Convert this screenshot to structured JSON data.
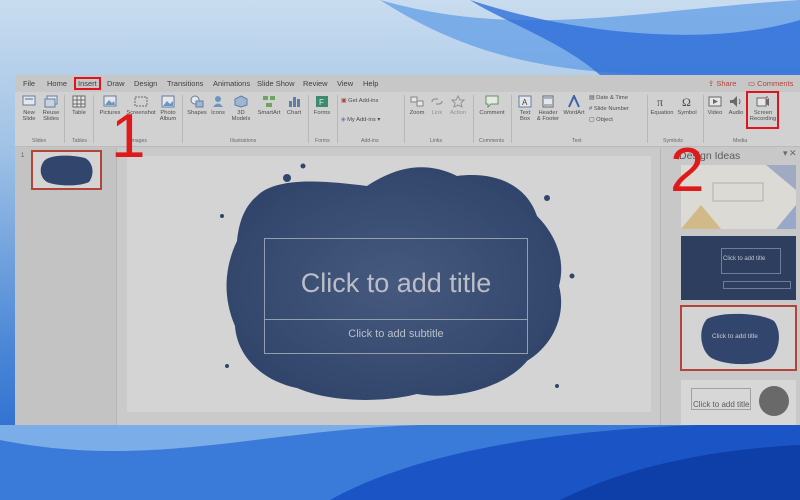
{
  "menubar": {
    "tabs": [
      "File",
      "Home",
      "Insert",
      "Draw",
      "Design",
      "Transitions",
      "Animations",
      "Slide Show",
      "Review",
      "View",
      "Help"
    ],
    "share": "Share",
    "comments": "Comments"
  },
  "ribbon": {
    "new_slide": "New\nSlide",
    "reuse_slides": "Reuse\nSlides",
    "table": "Table",
    "pictures": "Pictures",
    "screenshot": "Screenshot",
    "photo_album": "Photo\nAlbum",
    "shapes": "Shapes",
    "icons": "Icons",
    "models_3d": "3D\nModels",
    "smartart": "SmartArt",
    "chart": "Chart",
    "forms": "Forms",
    "get_addins": "Get Add-ins",
    "my_addins": "My Add-ins",
    "zoom": "Zoom",
    "link": "Link",
    "action": "Action",
    "comment": "Comment",
    "text_box": "Text\nBox",
    "header_footer": "Header\n& Footer",
    "wordart": "WordArt",
    "date_time": "Date & Time",
    "slide_number": "Slide Number",
    "object": "Object",
    "equation": "Equation",
    "symbol": "Symbol",
    "video": "Video",
    "audio": "Audio",
    "screen_recording": "Screen\nRecording",
    "groups": {
      "slides": "Slides",
      "tables": "Tables",
      "images": "Images",
      "illustrations": "Illustrations",
      "forms": "Forms",
      "addins": "Add-ins",
      "links": "Links",
      "comments": "Comments",
      "text": "Text",
      "symbols": "Symbols",
      "media": "Media"
    }
  },
  "thumbnails": {
    "slide_number": "1"
  },
  "slide": {
    "title_placeholder": "Click to add title",
    "subtitle_placeholder": "Click to add subtitle"
  },
  "design_pane": {
    "title": "Design Ideas",
    "thumb2_title": "Click to add title",
    "thumb3_title": "Click to add title",
    "thumb4_title": "Click to add title"
  },
  "annotations": {
    "step1": "1",
    "step2": "2"
  },
  "colors": {
    "accent_red": "#e0141e",
    "slide_blue": "#243a6b",
    "ribbon_bg": "#e4e4e4"
  }
}
